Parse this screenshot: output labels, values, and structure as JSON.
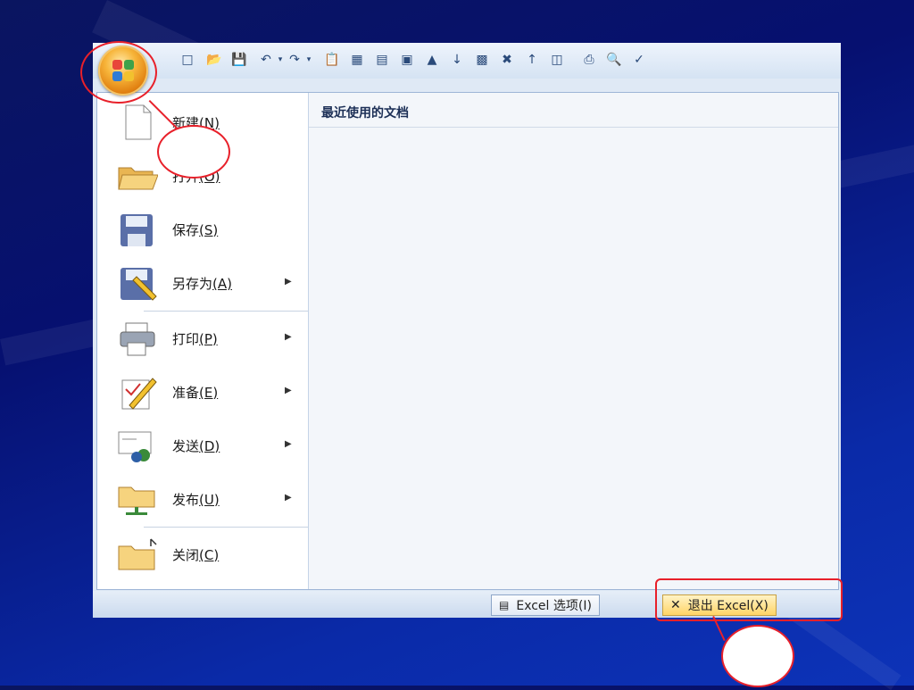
{
  "toolbar": {
    "icons": [
      "new-doc",
      "open-folder",
      "save",
      "undo",
      "undo-dropdown",
      "redo",
      "redo-dropdown",
      "paste",
      "insert-row",
      "insert-col",
      "delete-row",
      "picture",
      "sort-za",
      "calculator",
      "delete-cols",
      "sort-az",
      "freeze-panes",
      "print",
      "print-preview",
      "spell-check"
    ]
  },
  "menu": {
    "items": [
      {
        "label": "新建",
        "key": "(N)",
        "icon": "new-document-icon",
        "has_submenu": false
      },
      {
        "label": "打开",
        "key": "(O)",
        "icon": "open-folder-icon",
        "has_submenu": false
      },
      {
        "label": "保存",
        "key": "(S)",
        "icon": "save-icon",
        "has_submenu": false
      },
      {
        "label": "另存为",
        "key": "(A)",
        "icon": "save-as-icon",
        "has_submenu": true
      },
      {
        "label": "打印",
        "key": "(P)",
        "icon": "printer-icon",
        "has_submenu": true
      },
      {
        "label": "准备",
        "key": "(E)",
        "icon": "prepare-icon",
        "has_submenu": true
      },
      {
        "label": "发送",
        "key": "(D)",
        "icon": "send-icon",
        "has_submenu": true
      },
      {
        "label": "发布",
        "key": "(U)",
        "icon": "publish-icon",
        "has_submenu": true
      },
      {
        "label": "关闭",
        "key": "(C)",
        "icon": "close-folder-icon",
        "has_submenu": false
      }
    ],
    "recent_title": "最近使用的文档"
  },
  "footer": {
    "options_label": "Excel 选项(I)",
    "exit_label": "退出 Excel(X)"
  },
  "colors": {
    "accent": "#e8202a",
    "background": "#0a1c8a"
  }
}
